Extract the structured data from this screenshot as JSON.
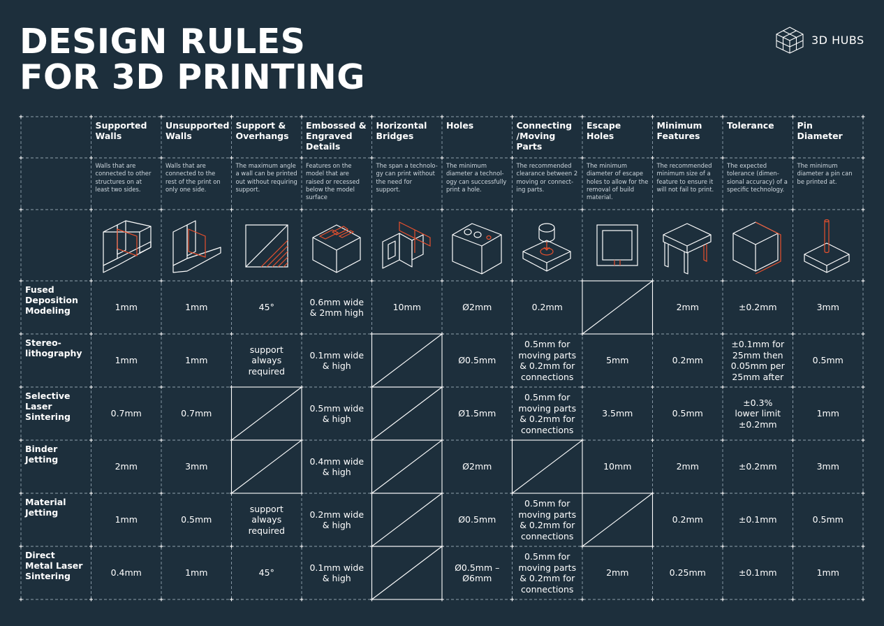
{
  "title": {
    "line1": "DESIGN RULES",
    "line2": "FOR 3D PRINTING"
  },
  "brand": {
    "name": "3D HUBS",
    "logo_icon": "hexagon-cube-logo"
  },
  "colors": {
    "background": "#1d2f3c",
    "text": "#ffffff",
    "accent": "#e8502d",
    "grid": "#8fa0ad"
  },
  "columns": [
    {
      "title": "Supported\nWalls",
      "desc": "Walls that are\nconnected to other\nstructures on at\nleast two sides.",
      "icon": "supported-walls-icon"
    },
    {
      "title": "Unsupported\nWalls",
      "desc": "Walls that are\nconnected to the\nrest of the print on\nonly one side.",
      "icon": "unsupported-walls-icon"
    },
    {
      "title": "Support &\nOverhangs",
      "desc": "The maximum angle\na wall can be printed\nout without requiring\nsupport.",
      "icon": "overhang-icon"
    },
    {
      "title": "Embossed &\nEngraved\nDetails",
      "desc": "Features on the\nmodel that are\nraised or recessed\nbelow the model\nsurface",
      "icon": "embossed-details-icon"
    },
    {
      "title": "Horizontal\nBridges",
      "desc": "The span a technolo-\ngy can print without\nthe need for\nsupport.",
      "icon": "bridge-icon"
    },
    {
      "title": "Holes",
      "desc": "The minimum\ndiameter a technol-\nogy can successfully\nprint a hole.",
      "icon": "holes-icon"
    },
    {
      "title": "Connecting\n/Moving\nParts",
      "desc": "The recommended\nclearance between 2\nmoving or connect-\ning parts.",
      "icon": "connecting-parts-icon"
    },
    {
      "title": "Escape\nHoles",
      "desc": "The minimum\ndiameter of escape\nholes to allow for the\nremoval of build\nmaterial.",
      "icon": "escape-holes-icon"
    },
    {
      "title": "Minimum\nFeatures",
      "desc": "The recommended\nminimum size of a\nfeature to ensure it\nwill not fail to print.",
      "icon": "minimum-features-icon"
    },
    {
      "title": "Tolerance",
      "desc": "The expected\ntolerance (dimen-\nsional accuracy) of a\nspecific technology.",
      "icon": "tolerance-icon"
    },
    {
      "title": "Pin\nDiameter",
      "desc": "The minimum\ndiameter a pin can\nbe printed at.",
      "icon": "pin-icon"
    }
  ],
  "rows": [
    {
      "title": "Fused\nDeposition\nModeling",
      "values": [
        "1mm",
        "1mm",
        "45°",
        "0.6mm wide\n& 2mm high",
        "10mm",
        "Ø2mm",
        "0.2mm",
        null,
        "2mm",
        "±0.2mm",
        "3mm"
      ]
    },
    {
      "title": "Stereo-\nlithography",
      "values": [
        "1mm",
        "1mm",
        "support\nalways\nrequired",
        "0.1mm wide\n& high",
        null,
        "Ø0.5mm",
        "0.5mm for\nmoving parts\n& 0.2mm for\nconnections",
        "5mm",
        "0.2mm",
        "±0.1mm for\n25mm then\n0.05mm per\n25mm after",
        "0.5mm"
      ]
    },
    {
      "title": "Selective\nLaser\nSintering",
      "values": [
        "0.7mm",
        "0.7mm",
        null,
        "0.5mm wide\n& high",
        null,
        "Ø1.5mm",
        "0.5mm for\nmoving parts\n& 0.2mm for\nconnections",
        "3.5mm",
        "0.5mm",
        "±0.3%\nlower limit\n±0.2mm",
        "1mm"
      ]
    },
    {
      "title": "Binder\nJetting",
      "values": [
        "2mm",
        "3mm",
        null,
        "0.4mm wide\n& high",
        null,
        "Ø2mm",
        null,
        "10mm",
        "2mm",
        "±0.2mm",
        "3mm"
      ]
    },
    {
      "title": "Material\nJetting",
      "values": [
        "1mm",
        "0.5mm",
        "support\nalways\nrequired",
        "0.2mm wide\n& high",
        null,
        "Ø0.5mm",
        "0.5mm for\nmoving parts\n& 0.2mm for\nconnections",
        null,
        "0.2mm",
        "±0.1mm",
        "0.5mm"
      ]
    },
    {
      "title": "Direct\nMetal Laser\nSintering",
      "values": [
        "0.4mm",
        "1mm",
        "45°",
        "0.1mm wide\n& high",
        null,
        "Ø0.5mm –\nØ6mm",
        "0.5mm for\nmoving parts\n& 0.2mm for\nconnections",
        "2mm",
        "0.25mm",
        "±0.1mm",
        "1mm"
      ]
    }
  ]
}
